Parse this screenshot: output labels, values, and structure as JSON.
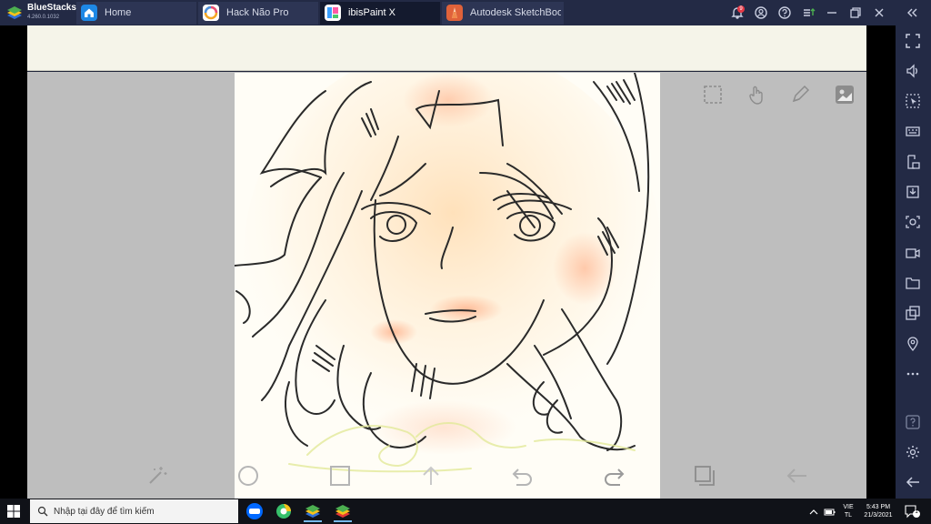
{
  "titlebar": {
    "brand_name": "BlueStacks",
    "brand_version": "4.260.0.1032",
    "notification_count": "9",
    "accent": "#232a45"
  },
  "tabs": [
    {
      "label": "Home",
      "icon": "home-icon"
    },
    {
      "label": "Hack Não Pro",
      "icon": "hack-nao-pro-app-icon"
    },
    {
      "label": "ibisPaint X",
      "icon": "ibispaint-app-icon"
    },
    {
      "label": "Autodesk SketchBook",
      "icon": "sketchbook-app-icon"
    }
  ],
  "canvas_tools": {
    "top": [
      "selection-icon",
      "hand-touch-icon",
      "pen-icon",
      "reference-image-icon"
    ],
    "bottom": [
      "magic-wand-icon",
      "circle-icon",
      "square-icon",
      "arrow-up-icon",
      "undo-icon",
      "redo-icon",
      "layers-icon",
      "back-arrow-icon"
    ]
  },
  "sidebar_icons": [
    "fullscreen-icon",
    "volume-icon",
    "cursor-icon",
    "keyboard-icon",
    "install-apk-icon",
    "media-import-icon",
    "screenshot-icon",
    "record-video-icon",
    "folder-icon",
    "multi-instance-icon",
    "location-icon",
    "more-icon",
    "help-icon",
    "settings-icon",
    "back-icon"
  ],
  "taskbar": {
    "search_placeholder": "Nhập tại đây để tìm kiếm",
    "language_top": "VIE",
    "language_bottom": "TL",
    "time": "5:43 PM",
    "date": "21/3/2021",
    "notification_count": "1"
  }
}
